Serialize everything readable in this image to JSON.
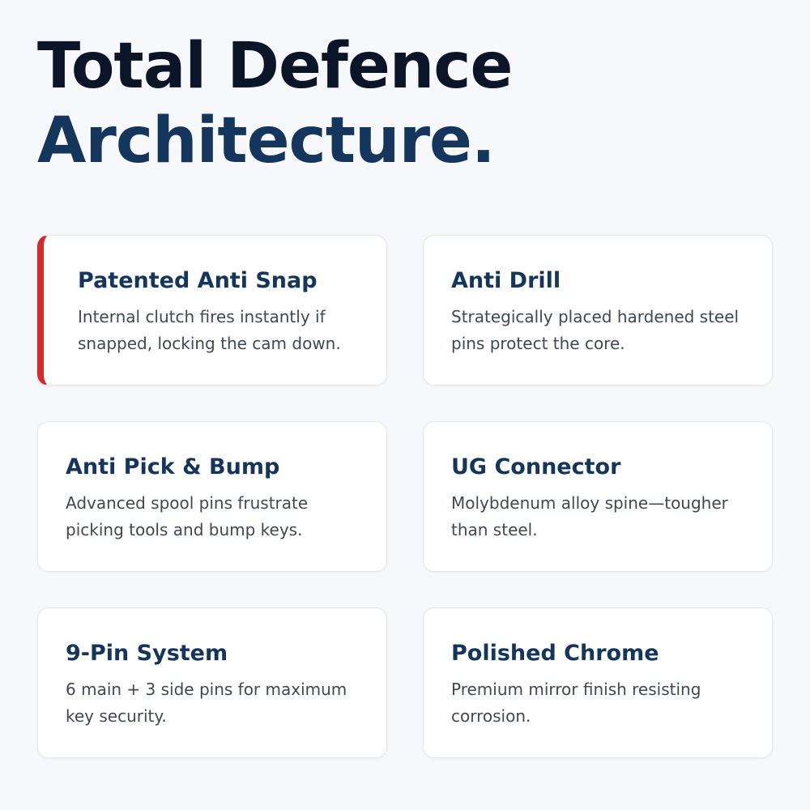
{
  "headline": {
    "line1": "Total Defence",
    "line2": "Architecture."
  },
  "features": [
    {
      "title": "Patented Anti Snap",
      "description": "Internal clutch fires instantly if snapped, locking the cam down.",
      "highlighted": true
    },
    {
      "title": "Anti Drill",
      "description": "Strategically placed hardened steel pins protect the core.",
      "highlighted": false
    },
    {
      "title": "Anti Pick & Bump",
      "description": "Advanced spool pins frustrate picking tools and bump keys.",
      "highlighted": false
    },
    {
      "title": "UG Connector",
      "description": "Molybdenum alloy spine—tougher than steel.",
      "highlighted": false
    },
    {
      "title": "9-Pin System",
      "description": "6 main + 3 side pins for maximum key security.",
      "highlighted": false
    },
    {
      "title": "Polished Chrome",
      "description": "Premium mirror finish resisting corrosion.",
      "highlighted": false
    }
  ],
  "colors": {
    "background": "#f6f8fb",
    "headline_dark": "#0c1428",
    "headline_navy": "#15365c",
    "accent_red": "#d62828",
    "body_text": "#3f4855"
  }
}
